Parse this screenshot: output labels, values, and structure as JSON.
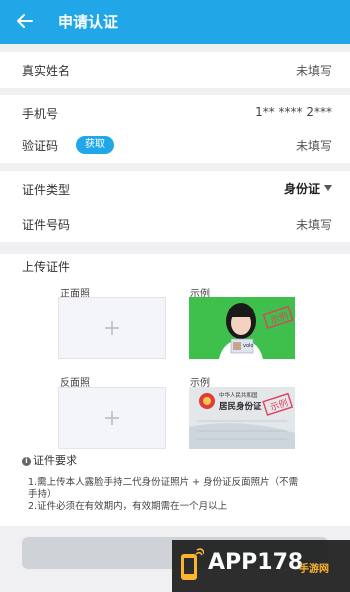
{
  "header": {
    "title": "申请认证"
  },
  "form": {
    "name": {
      "label": "真实姓名",
      "value": "未填写"
    },
    "phone": {
      "label": "手机号",
      "value": "1** **** 2***"
    },
    "code": {
      "label": "验证码",
      "button": "获取",
      "value": "未填写"
    },
    "id_type": {
      "label": "证件类型",
      "value": "身份证"
    },
    "id_number": {
      "label": "证件号码",
      "value": "未填写"
    }
  },
  "upload": {
    "title": "上传证件",
    "front_label": "正面照",
    "back_label": "反面照",
    "sample_label": "示例",
    "sample_stamp": "示例",
    "id_card_header": "中华人民共和国",
    "id_card_title": "居民身份证"
  },
  "requirements": {
    "title": "证件要求",
    "line1": "1.需上传本人露脸手持二代身份证照片 + 身份证反面照片（不需",
    "line1b": "手持）",
    "line2": "2.证件必须在有效期内，有效期需在一个月以上"
  },
  "watermark": {
    "brand": "APP178",
    "sub": "手游网"
  },
  "colors": {
    "accent": "#21a7e8",
    "background": "#f0f0f3"
  }
}
